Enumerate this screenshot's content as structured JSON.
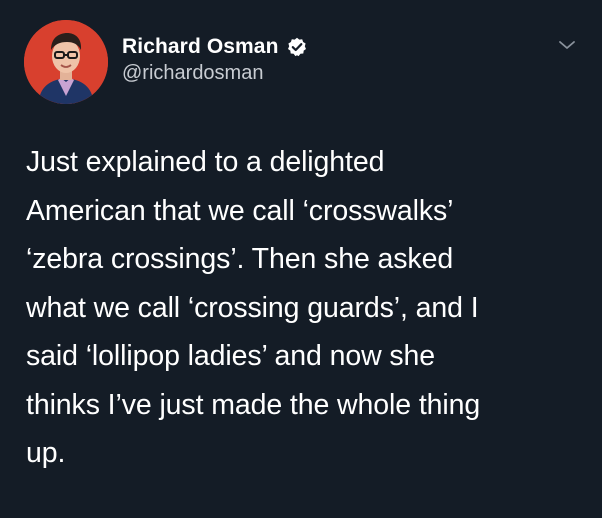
{
  "tweet": {
    "author": {
      "display_name": "Richard Osman",
      "handle": "@richardosman",
      "verified_icon": "verified-badge-icon",
      "avatar_icon": "profile-photo"
    },
    "menu_icon": "chevron-down-icon",
    "text_lines": [
      "Just explained to a delighted",
      "American that we call ‘crosswalks’",
      "‘zebra crossings’. Then she asked",
      "what we call ‘crossing guards’, and I",
      "said ‘lollipop ladies’ and now she",
      "thinks I’ve just made the whole thing",
      "up."
    ]
  },
  "colors": {
    "background": "#141c26",
    "text": "#ffffff",
    "handle": "#c8ccd2",
    "avatar_bg": "#d8402e"
  }
}
